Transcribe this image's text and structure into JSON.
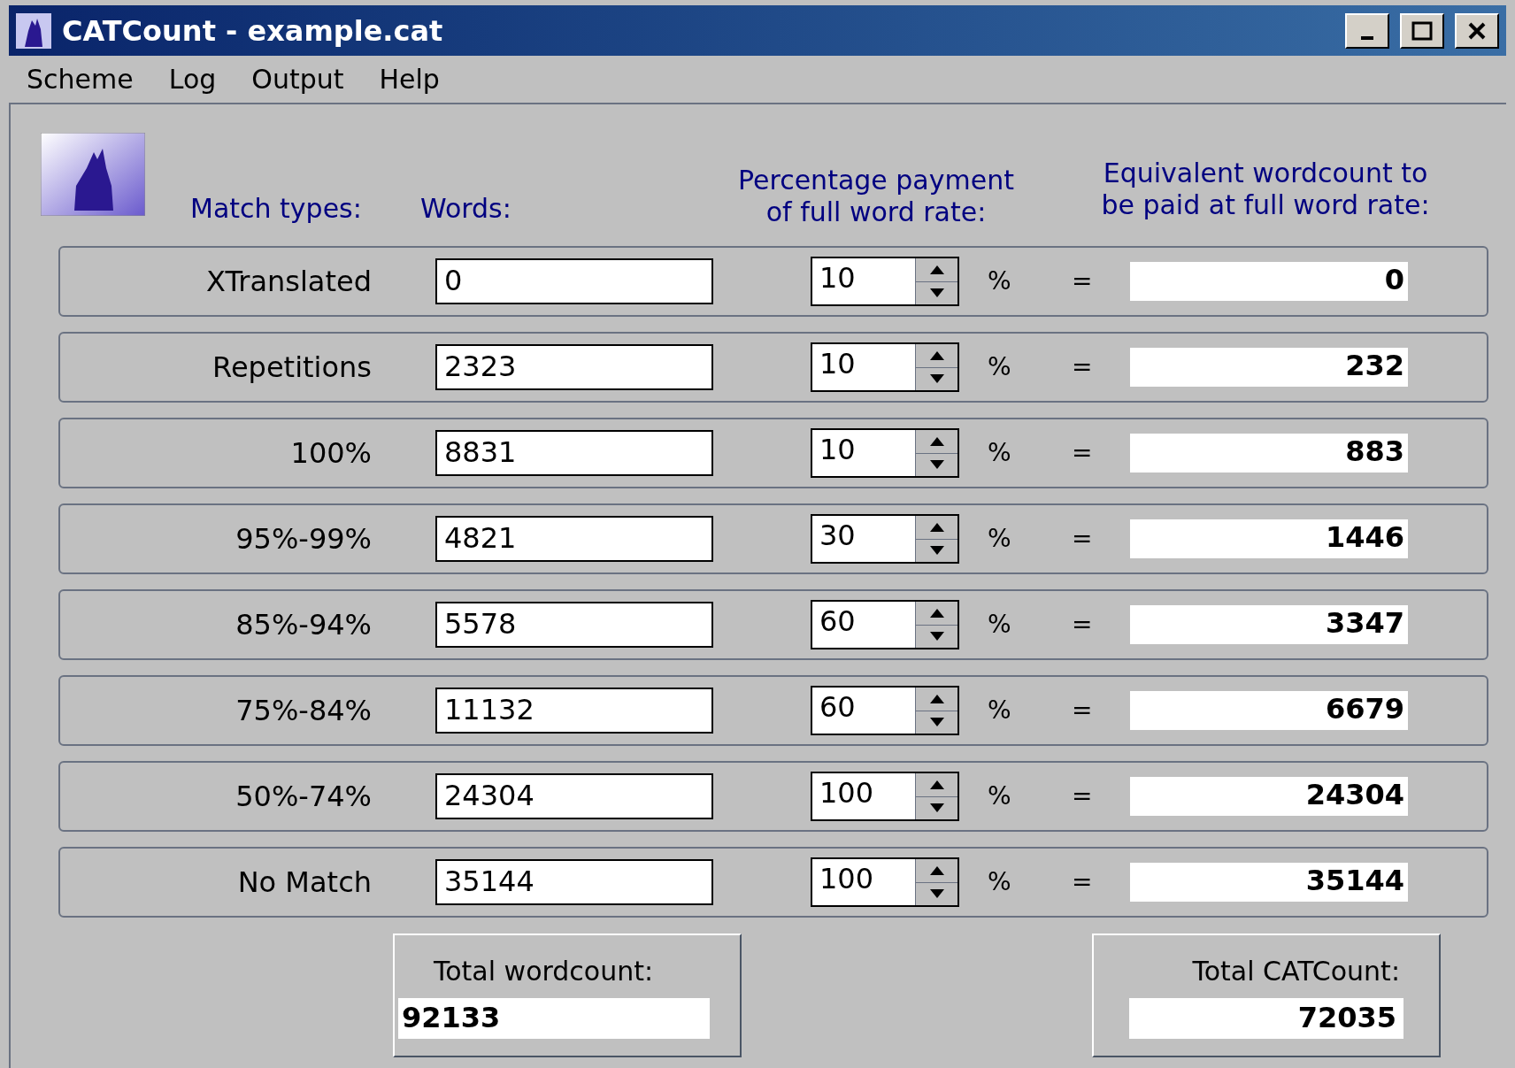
{
  "window": {
    "title": "CATCount - example.cat"
  },
  "menu": [
    "Scheme",
    "Log",
    "Output",
    "Help"
  ],
  "headers": {
    "match_types": "Match types:",
    "words": "Words:",
    "percentage": [
      "Percentage payment",
      "of full word rate:"
    ],
    "equivalent": [
      "Equivalent wordcount to",
      "be paid at full word rate:"
    ]
  },
  "rows": [
    {
      "label": "XTranslated",
      "words": "0",
      "percentage": "10",
      "unit": "%",
      "equals": "=",
      "result": "0"
    },
    {
      "label": "Repetitions",
      "words": "2323",
      "percentage": "10",
      "unit": "%",
      "equals": "=",
      "result": "232"
    },
    {
      "label": "100%",
      "words": "8831",
      "percentage": "10",
      "unit": "%",
      "equals": "=",
      "result": "883"
    },
    {
      "label": "95%-99%",
      "words": "4821",
      "percentage": "30",
      "unit": "%",
      "equals": "=",
      "result": "1446"
    },
    {
      "label": "85%-94%",
      "words": "5578",
      "percentage": "60",
      "unit": "%",
      "equals": "=",
      "result": "3347"
    },
    {
      "label": "75%-84%",
      "words": "11132",
      "percentage": "60",
      "unit": "%",
      "equals": "=",
      "result": "6679"
    },
    {
      "label": "50%-74%",
      "words": "24304",
      "percentage": "100",
      "unit": "%",
      "equals": "=",
      "result": "24304"
    },
    {
      "label": "No Match",
      "words": "35144",
      "percentage": "100",
      "unit": "%",
      "equals": "=",
      "result": "35144"
    }
  ],
  "totals": [
    {
      "label": "Total wordcount:",
      "value": "92133",
      "kind": "wordcount"
    },
    {
      "label": "Total CATCount:",
      "value": "72035",
      "kind": "catcount"
    }
  ]
}
